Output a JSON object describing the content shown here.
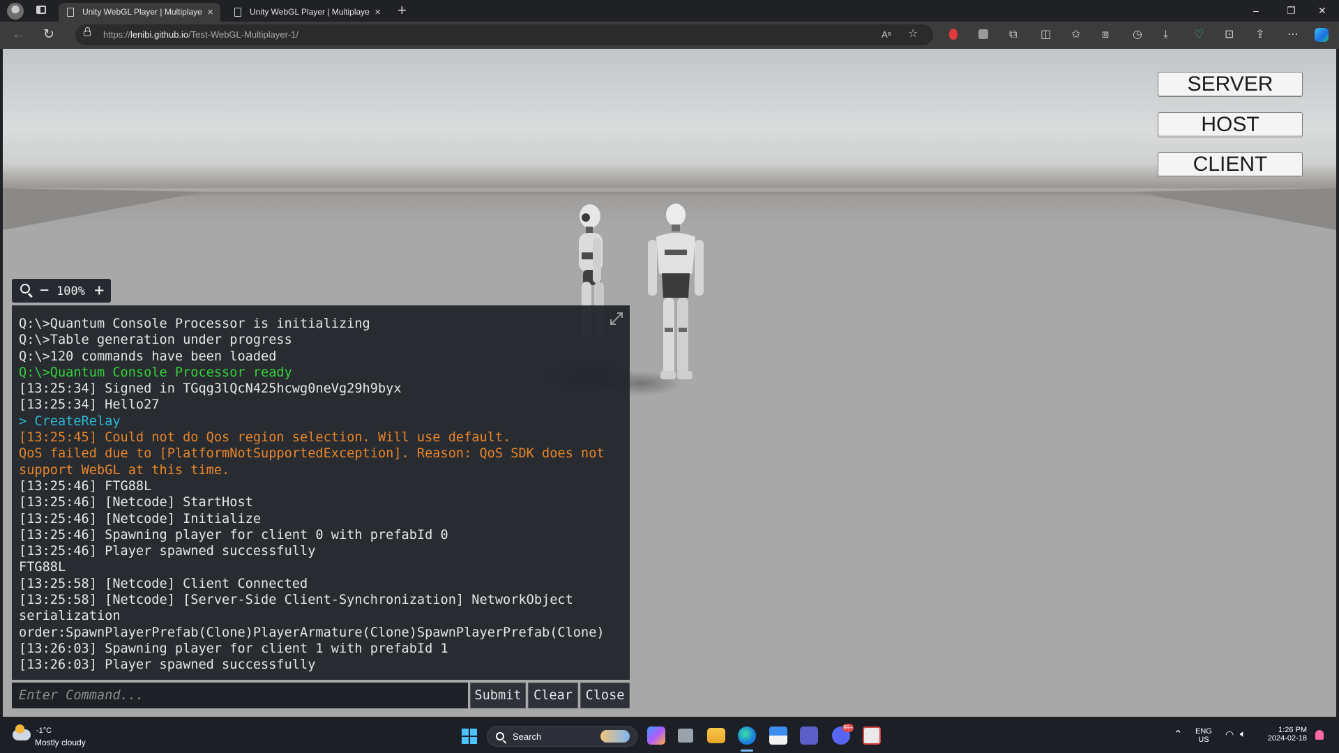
{
  "browser": {
    "tabs": [
      {
        "title": "Unity WebGL Player | Multiplayer",
        "active": true
      },
      {
        "title": "Unity WebGL Player | Multiplayer",
        "active": false
      }
    ],
    "new_tab_glyph": "+",
    "window_controls": {
      "minimize": "–",
      "restore": "❐",
      "close": "✕"
    },
    "url": {
      "scheme": "https://",
      "host": "lenibi.github.io",
      "path": "/Test-WebGL-Multiplayer-1/"
    },
    "icons": [
      "back-icon",
      "refresh-icon",
      "lock-icon",
      "read-aloud-icon",
      "favorite-star-icon",
      "extensions-icon",
      "split-screen-icon",
      "favorites-icon",
      "collections-icon",
      "history-icon",
      "download-icon",
      "performance-icon",
      "screenshot-icon",
      "share-icon",
      "more-icon",
      "copilot-icon"
    ]
  },
  "game": {
    "network_buttons": {
      "server": "SERVER",
      "host": "HOST",
      "client": "CLIENT"
    },
    "zoom": {
      "minus": "−",
      "value": "100%",
      "plus": "+"
    },
    "console": {
      "lines": [
        {
          "text": "Q:\\>Quantum Console Processor is initializing",
          "type": "normal"
        },
        {
          "text": "Q:\\>Table generation under progress",
          "type": "normal"
        },
        {
          "text": "Q:\\>120 commands have been loaded",
          "type": "normal"
        },
        {
          "text": "Q:\\>Quantum Console Processor ready",
          "type": "success"
        },
        {
          "text": "[13:25:34] Signed in TGqg3lQcN425hcwg0neVg29h9byx",
          "type": "normal"
        },
        {
          "text": "[13:25:34] Hello27",
          "type": "normal"
        },
        {
          "text": "> CreateRelay",
          "type": "command"
        },
        {
          "text": "[13:25:45] Could not do Qos region selection. Will use default.",
          "type": "warning"
        },
        {
          "text": "QoS failed due to [PlatformNotSupportedException]. Reason: QoS SDK does not support WebGL at this time.",
          "type": "warning"
        },
        {
          "text": "[13:25:46] FTG88L",
          "type": "normal"
        },
        {
          "text": "[13:25:46] [Netcode] StartHost",
          "type": "normal"
        },
        {
          "text": "[13:25:46] [Netcode] Initialize",
          "type": "normal"
        },
        {
          "text": "[13:25:46] Spawning player for client 0 with prefabId 0",
          "type": "normal"
        },
        {
          "text": "[13:25:46] Player spawned successfully",
          "type": "normal"
        },
        {
          "text": "FTG88L",
          "type": "normal"
        },
        {
          "text": "[13:25:58] [Netcode] Client Connected",
          "type": "normal"
        },
        {
          "text": "[13:25:58] [Netcode] [Server-Side Client-Synchronization] NetworkObject serialization order:SpawnPlayerPrefab(Clone)PlayerArmature(Clone)SpawnPlayerPrefab(Clone)",
          "type": "normal"
        },
        {
          "text": "[13:26:03] Spawning player for client 1 with prefabId 1",
          "type": "normal"
        },
        {
          "text": "[13:26:03] Player spawned successfully",
          "type": "normal"
        }
      ],
      "input_placeholder": "Enter Command...",
      "input_value": "",
      "buttons": {
        "submit": "Submit",
        "clear": "Clear",
        "close": "Close"
      },
      "colors": {
        "normal": "#e6e6e6",
        "success": "#34d13b",
        "command": "#2ab8d6",
        "warning": "#e8852b"
      }
    }
  },
  "taskbar": {
    "weather": {
      "temp": "-1°C",
      "desc": "Mostly cloudy"
    },
    "search_label": "Search",
    "chat_badge": "99+",
    "language": {
      "lang": "ENG",
      "region": "US"
    },
    "clock": {
      "time": "1:26 PM",
      "date": "2024-02-18"
    }
  }
}
